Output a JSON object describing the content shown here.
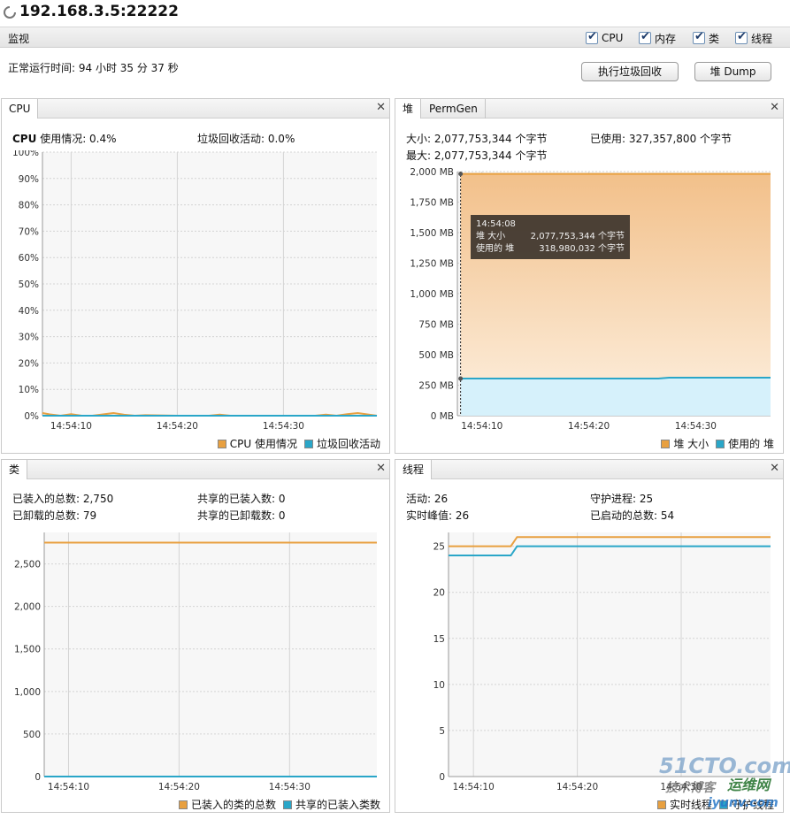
{
  "window": {
    "title": "192.168.3.5:22222"
  },
  "monitor": {
    "label": "监视",
    "checkboxes": [
      {
        "label": "CPU",
        "checked": true
      },
      {
        "label": "内存",
        "checked": true
      },
      {
        "label": "类",
        "checked": true
      },
      {
        "label": "线程",
        "checked": true
      }
    ],
    "uptime": "正常运行时间: 94 小时 35 分 37 秒",
    "buttons": {
      "gc": "执行垃圾回收",
      "dump": "堆 Dump"
    }
  },
  "cpu_panel": {
    "tab": "CPU",
    "usage_label": "CPU",
    "usage_text": "使用情况: 0.4%",
    "gc_text": "垃圾回收活动: 0.0%",
    "legend": [
      "CPU 使用情况",
      "垃圾回收活动"
    ]
  },
  "heap_panel": {
    "tabs": [
      "堆",
      "PermGen"
    ],
    "size": "大小: 2,077,753,344 个字节",
    "used": "已使用: 327,357,800 个字节",
    "max": "最大: 2,077,753,344 个字节",
    "tooltip": {
      "time": "14:54:08",
      "rows": [
        {
          "label": "堆 大小",
          "value": "2,077,753,344 个字节"
        },
        {
          "label": "使用的 堆",
          "value": "318,980,032 个字节"
        }
      ]
    },
    "legend": [
      "堆 大小",
      "使用的 堆"
    ]
  },
  "class_panel": {
    "tab": "类",
    "loaded": "已装入的总数: 2,750",
    "unloaded": "已卸载的总数: 79",
    "shared_loaded": "共享的已装入数: 0",
    "shared_unloaded": "共享的已卸载数: 0",
    "legend": [
      "已装入的类的总数",
      "共享的已装入类数"
    ]
  },
  "thread_panel": {
    "tab": "线程",
    "live": "活动: 26",
    "peak": "实时峰值: 26",
    "daemon": "守护进程: 25",
    "started": "已启动的总数: 54",
    "legend": [
      "实时线程",
      "守护线程"
    ]
  },
  "colors": {
    "orange": "#e8a040",
    "blue": "#2aa6c8",
    "heap_fill_top": "#f2c08a",
    "used_fill": "#d6f1fb"
  },
  "watermarks": {
    "w1": "51CTO.com",
    "w2": "技术博客",
    "w3": "运维网",
    "w4": "iyunv.com"
  },
  "chart_data": [
    {
      "id": "cpu",
      "type": "line",
      "ylim": [
        0,
        100
      ],
      "yticks": [
        0,
        10,
        20,
        30,
        40,
        50,
        60,
        70,
        80,
        90,
        100
      ],
      "ytick_labels": [
        "0%",
        "10%",
        "20%",
        "30%",
        "40%",
        "50%",
        "60%",
        "70%",
        "80%",
        "90%",
        "100%"
      ],
      "xlim": [
        7.3,
        38.8
      ],
      "xticks": [
        10,
        20,
        30
      ],
      "xtick_labels": [
        "14:54:10",
        "14:54:20",
        "14:54:30"
      ],
      "series": [
        {
          "name": "CPU 使用情况",
          "x": [
            7.3,
            8,
            9,
            10,
            11,
            12,
            13,
            14,
            15,
            16,
            17,
            20,
            23,
            24,
            25,
            30,
            33,
            34,
            35,
            36,
            37,
            38.8
          ],
          "values": [
            1.0,
            0.5,
            0.0,
            0.6,
            0.0,
            0.0,
            0.5,
            1.0,
            0.4,
            0.0,
            0.2,
            0.0,
            0.0,
            0.4,
            0.0,
            0.0,
            0.0,
            0.4,
            0.0,
            0.6,
            1.0,
            0.0
          ]
        },
        {
          "name": "垃圾回收活动",
          "x": [
            7.3,
            38.8
          ],
          "values": [
            0,
            0
          ]
        }
      ]
    },
    {
      "id": "heap",
      "type": "area",
      "ylim": [
        0,
        2000
      ],
      "yticks": [
        0,
        250,
        500,
        750,
        1000,
        1250,
        1500,
        1750,
        2000
      ],
      "ytick_labels": [
        "0 MB",
        "250 MB",
        "500 MB",
        "750 MB",
        "1,000 MB",
        "1,250 MB",
        "1,500 MB",
        "1,750 MB",
        "2,000 MB"
      ],
      "xlim": [
        7.7,
        37.0
      ],
      "xticks": [
        10,
        20,
        30
      ],
      "xtick_labels": [
        "14:54:10",
        "14:54:20",
        "14:54:30"
      ],
      "series": [
        {
          "name": "堆 大小",
          "x": [
            8,
            37.0
          ],
          "values": [
            1981,
            1981
          ]
        },
        {
          "name": "使用的 堆",
          "x": [
            8,
            26.5,
            27.5,
            37.0
          ],
          "values": [
            304,
            304,
            312,
            312
          ]
        }
      ]
    },
    {
      "id": "classes",
      "type": "line",
      "ylim": [
        0,
        2870
      ],
      "yticks": [
        0,
        500,
        1000,
        1500,
        2000,
        2500
      ],
      "ytick_labels": [
        "0",
        "500",
        "1,000",
        "1,500",
        "2,000",
        "2,500"
      ],
      "xlim": [
        7.8,
        37.9
      ],
      "xticks": [
        10,
        20,
        30
      ],
      "xtick_labels": [
        "14:54:10",
        "14:54:20",
        "14:54:30"
      ],
      "series": [
        {
          "name": "已装入的类的总数",
          "x": [
            7.8,
            37.9
          ],
          "values": [
            2750,
            2750
          ]
        },
        {
          "name": "共享的已装入类数",
          "x": [
            7.8,
            37.9
          ],
          "values": [
            0,
            0
          ]
        }
      ]
    },
    {
      "id": "threads",
      "type": "line",
      "ylim": [
        0,
        26.5
      ],
      "yticks": [
        0,
        5,
        10,
        15,
        20,
        25
      ],
      "ytick_labels": [
        "0",
        "5",
        "10",
        "15",
        "20",
        "25"
      ],
      "xlim": [
        7.6,
        38.6
      ],
      "xticks": [
        10,
        20,
        30
      ],
      "xtick_labels": [
        "14:54:10",
        "14:54:20",
        "14:54:30"
      ],
      "series": [
        {
          "name": "实时线程",
          "x": [
            7.6,
            13.6,
            14.2,
            38.6
          ],
          "values": [
            25,
            25,
            26,
            26
          ]
        },
        {
          "name": "守护线程",
          "x": [
            7.6,
            13.6,
            14.2,
            38.6
          ],
          "values": [
            24,
            24,
            25,
            25
          ]
        }
      ]
    }
  ]
}
